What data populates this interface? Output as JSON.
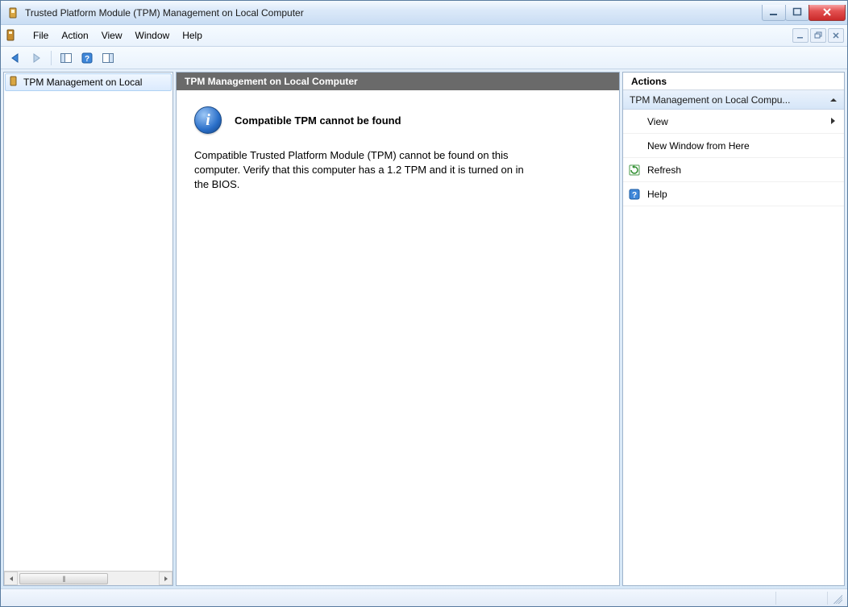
{
  "titlebar": {
    "title": "Trusted Platform Module (TPM) Management on Local Computer"
  },
  "menu": {
    "items": [
      "File",
      "Action",
      "View",
      "Window",
      "Help"
    ]
  },
  "toolbar": {
    "back_icon": "nav-back-icon",
    "forward_icon": "nav-forward-icon",
    "panel_icon": "panel-icon",
    "help_icon": "help-icon",
    "panel2_icon": "panel2-icon"
  },
  "tree": {
    "root_label": "TPM Management on Local"
  },
  "center": {
    "header": "TPM Management on Local Computer",
    "status_title": "Compatible TPM cannot be found",
    "status_msg": "Compatible Trusted Platform Module (TPM) cannot be found on this computer. Verify that this computer has a 1.2 TPM and it is turned on in the BIOS."
  },
  "actions": {
    "header": "Actions",
    "group": "TPM Management on Local Compu...",
    "items": [
      {
        "label": "View",
        "submenu": true,
        "icon": ""
      },
      {
        "label": "New Window from Here",
        "submenu": false,
        "icon": ""
      },
      {
        "label": "Refresh",
        "submenu": false,
        "icon": "refresh-icon"
      },
      {
        "label": "Help",
        "submenu": false,
        "icon": "help-icon"
      }
    ]
  }
}
